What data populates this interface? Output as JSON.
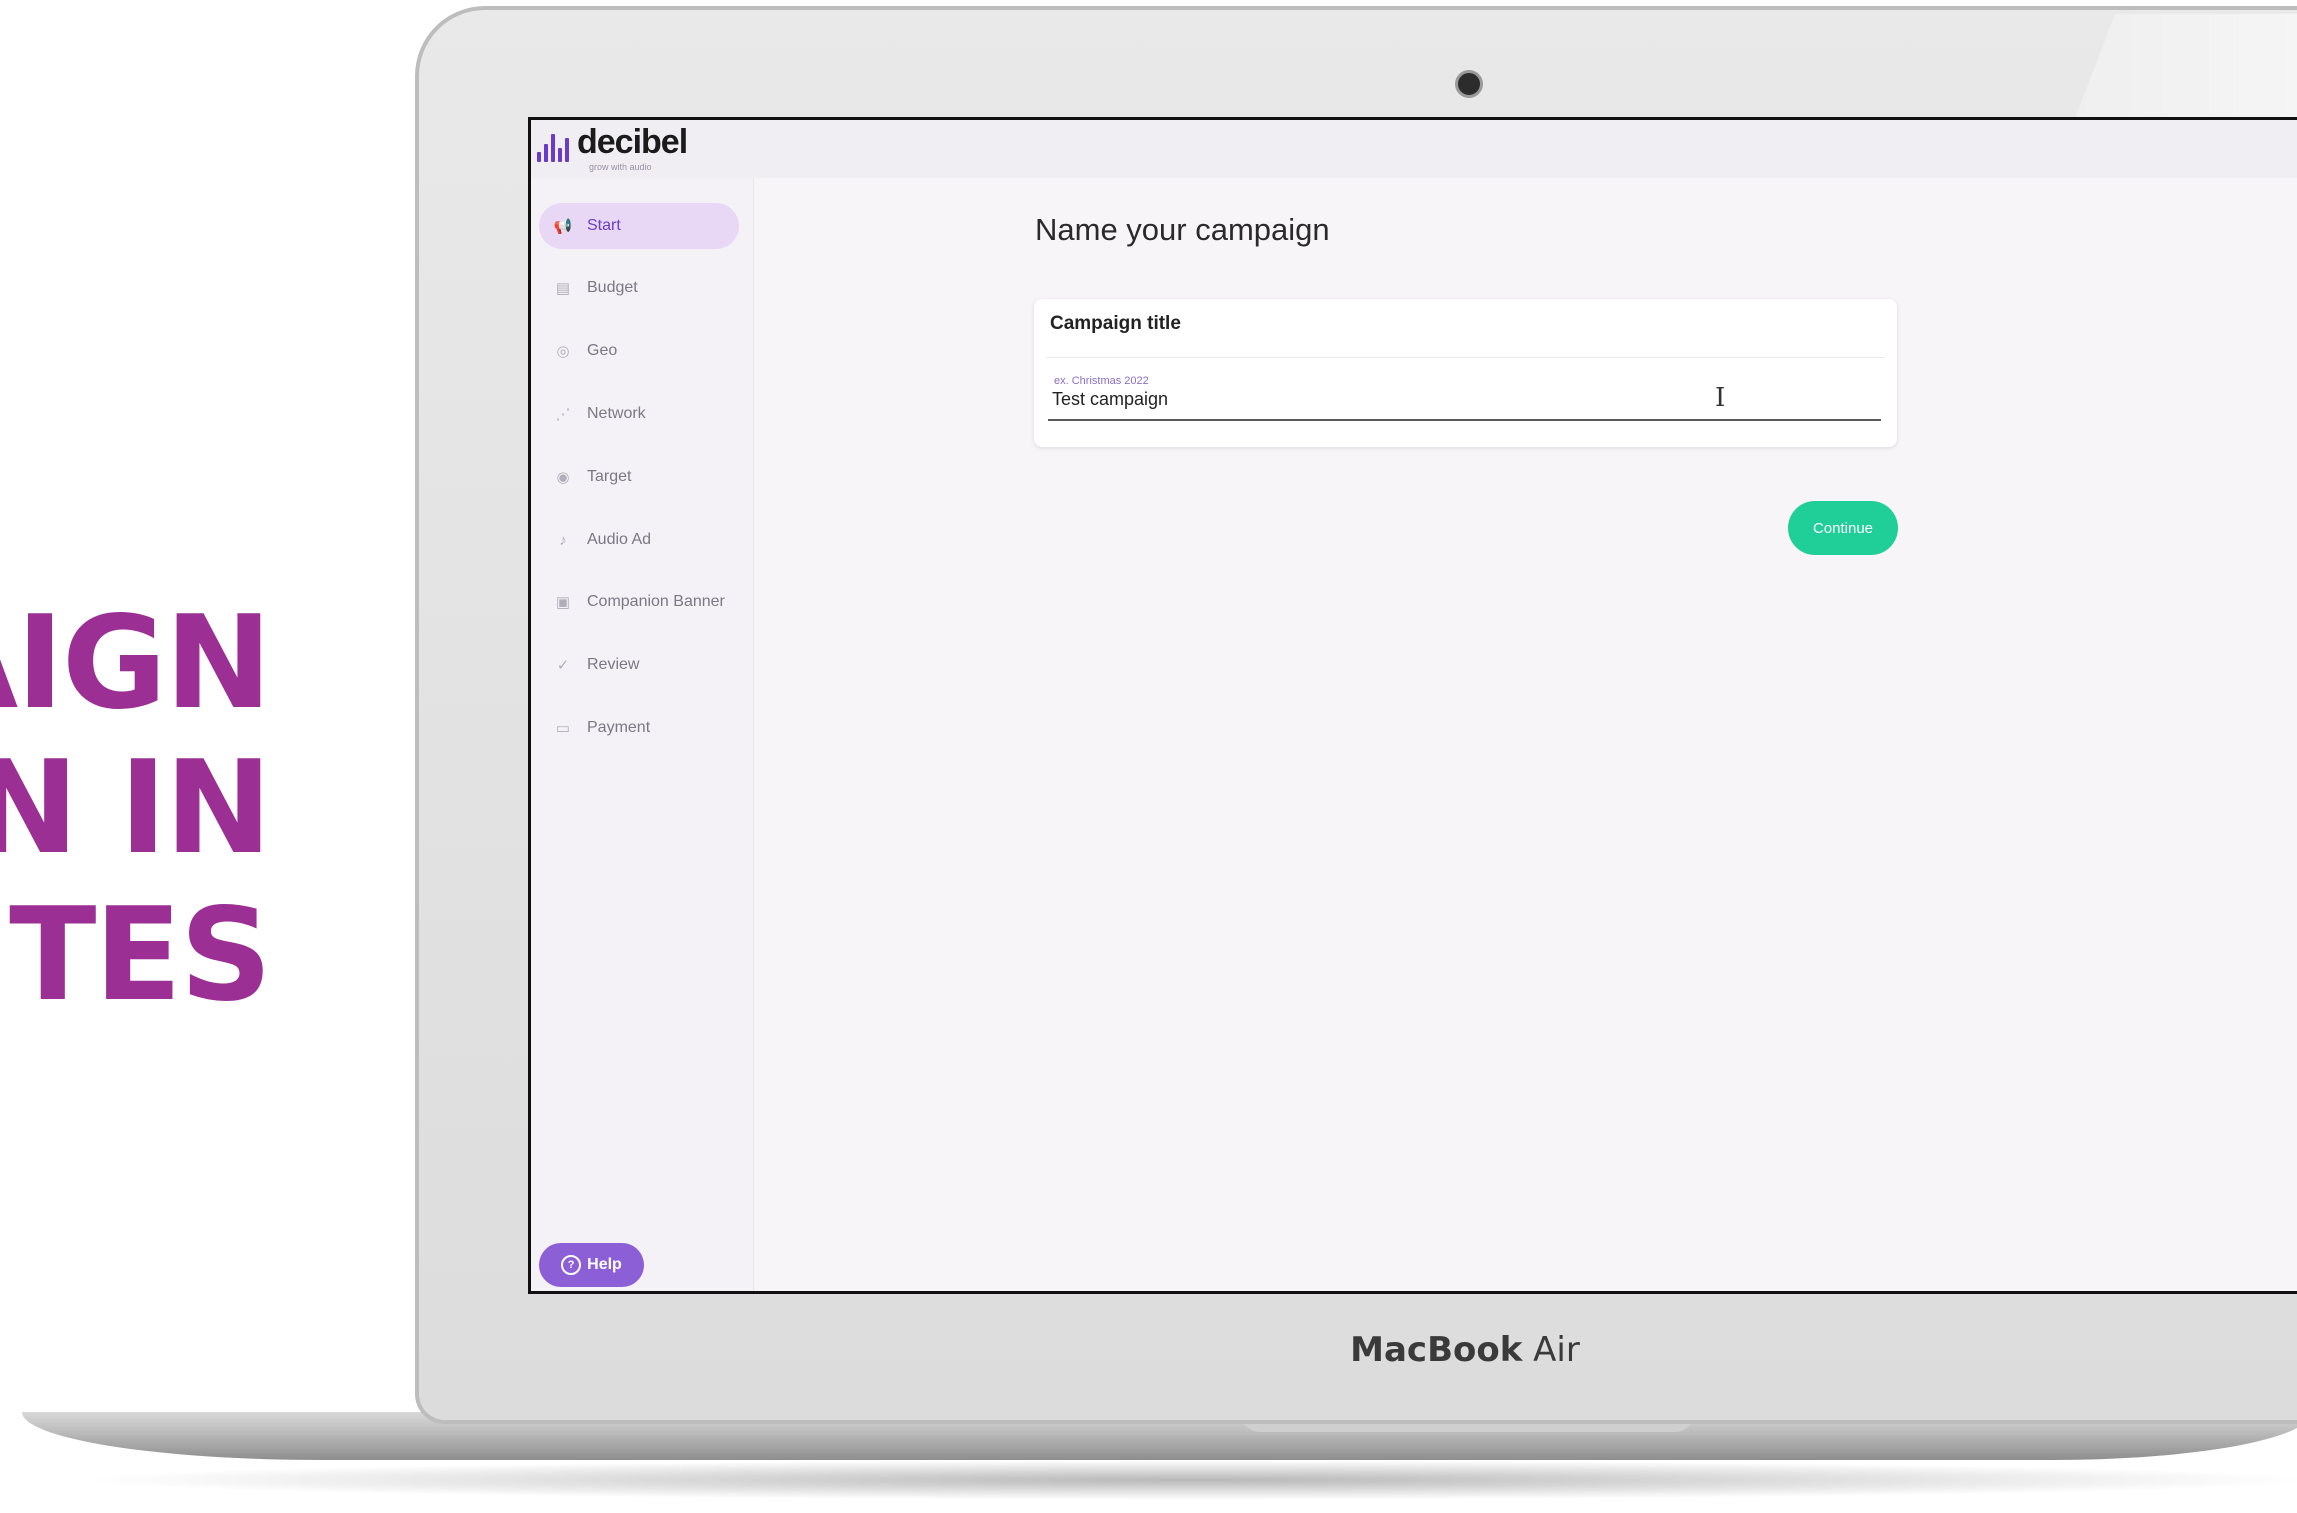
{
  "headline": {
    "line1": "AIGN",
    "line2": "N IN",
    "line3": "TES"
  },
  "app": {
    "logo_text": "decibel",
    "tagline": "grow with audio"
  },
  "sidebar": {
    "items": [
      {
        "label": "Start",
        "icon": "megaphone-icon",
        "active": true
      },
      {
        "label": "Budget",
        "icon": "budget-icon"
      },
      {
        "label": "Geo",
        "icon": "location-pin-icon"
      },
      {
        "label": "Network",
        "icon": "network-icon"
      },
      {
        "label": "Target",
        "icon": "target-icon"
      },
      {
        "label": "Audio Ad",
        "icon": "microphone-icon"
      },
      {
        "label": "Companion Banner",
        "icon": "image-icon"
      },
      {
        "label": "Review",
        "icon": "review-icon"
      },
      {
        "label": "Payment",
        "icon": "credit-card-icon"
      }
    ],
    "help_label": "Help"
  },
  "main": {
    "title": "Name your campaign",
    "card_title": "Campaign title",
    "field_placeholder": "ex. Christmas 2022",
    "field_value": "Test campaign",
    "continue_label": "Continue"
  },
  "laptop": {
    "brand_bold": "MacBook",
    "brand_light": "Air"
  },
  "colors": {
    "headline": "#9b2f94",
    "accent": "#8c5fd6",
    "active_nav_bg": "#e8d8f6",
    "continue_button": "#1fcf97"
  }
}
